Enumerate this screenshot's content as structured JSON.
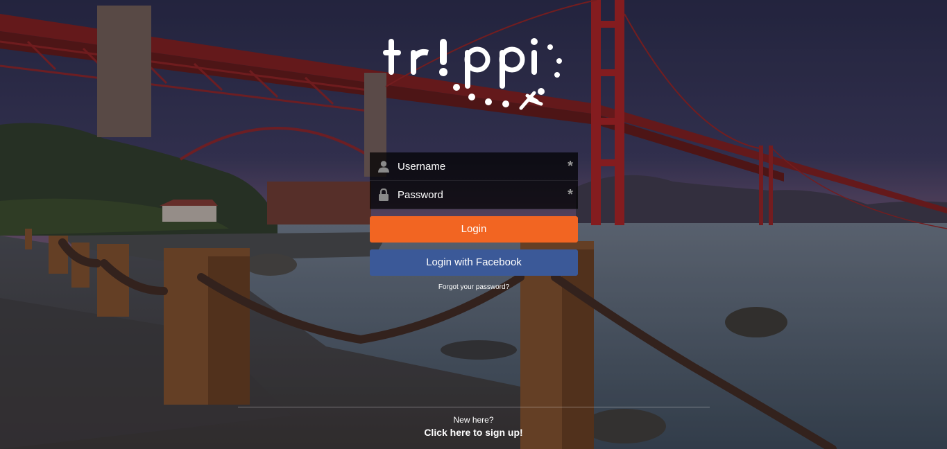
{
  "brand": {
    "logo_text": "trippi"
  },
  "login_form": {
    "username": {
      "placeholder": "Username",
      "value": "",
      "required_marker": "*"
    },
    "password": {
      "placeholder": "Password",
      "value": "",
      "required_marker": "*"
    },
    "login_button": "Login",
    "facebook_button": "Login with Facebook",
    "forgot_link": "Forgot your password?"
  },
  "footer": {
    "new_here": "New here?",
    "signup_link": "Click here to sign up!"
  },
  "colors": {
    "login_button": "#f26522",
    "facebook_button": "#3b5998",
    "field_background": "rgba(0,0,0,0.72)"
  },
  "icons": {
    "username": "user-icon",
    "password": "lock-icon"
  }
}
